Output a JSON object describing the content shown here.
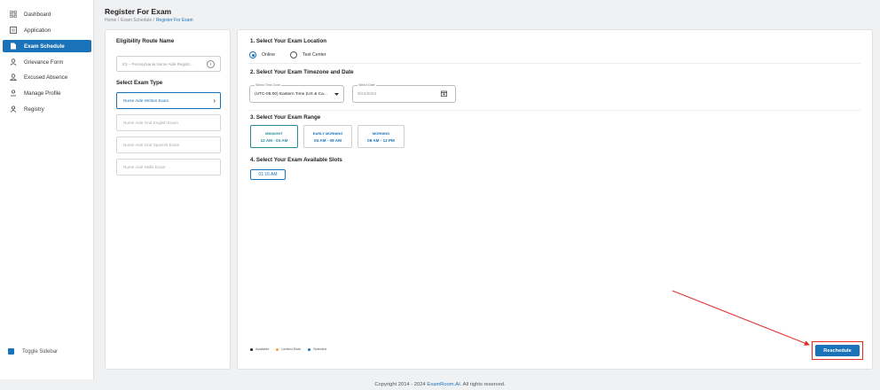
{
  "sidebar": {
    "items": [
      {
        "label": "Dashboard",
        "icon": "grid-icon"
      },
      {
        "label": "Application",
        "icon": "document-icon"
      },
      {
        "label": "Exam Schedule",
        "icon": "file-icon",
        "active": true
      },
      {
        "label": "Grievance Form",
        "icon": "user-icon"
      },
      {
        "label": "Excused Absence",
        "icon": "user-warning-icon"
      },
      {
        "label": "Manage Profile",
        "icon": "profile-icon"
      },
      {
        "label": "Registry",
        "icon": "registry-icon"
      }
    ],
    "toggle_label": "Toggle Sidebar"
  },
  "header": {
    "title": "Register For Exam",
    "breadcrumb": [
      "Home /",
      "Exam Schedule /",
      "Register For Exam"
    ]
  },
  "left": {
    "route_heading": "Eligibility Route Name",
    "route_value": "E3 – Pennsylvania Nurse Aide Registr...",
    "exam_type_heading": "Select Exam Type",
    "exam_types": [
      "Nurse Aide Written Exam",
      "Nurse Aide Oral English Exam",
      "Nurse Aide Oral Spanish Exam",
      "Nurse Aide Skills Exam"
    ]
  },
  "right": {
    "sec1": "1. Select Your Exam Location",
    "location_online": "Online",
    "location_center": "Test Center",
    "sec2": "2. Select Your Exam Timezone and Date",
    "timezone_label": "Select Time Zone",
    "timezone_value": "(UTC-05:00) Eastern Time (US & Ca...",
    "date_label": "Select Date",
    "date_value": "8/24/2024",
    "sec3": "3. Select Your Exam Range",
    "ranges": [
      {
        "name": "MIDNIGHT",
        "time": "12 AM - 04 AM"
      },
      {
        "name": "EARLY MORNING",
        "time": "04 AM - 08 AM"
      },
      {
        "name": "MORNING",
        "time": "08 AM - 12 PM"
      }
    ],
    "sec4": "4. Select Your Exam Available Slots",
    "slot": "01:16 AM",
    "legend": [
      {
        "label": "Available",
        "color": "#222222"
      },
      {
        "label": "Limited Slots",
        "color": "#f0a030"
      },
      {
        "label": "Selected",
        "color": "#1a73b8"
      }
    ],
    "reschedule_label": "Reschedule"
  },
  "footer": {
    "text_pre": "Copyright 2014 - 2024",
    "brand": "ExamRoom.AI.",
    "text_post": "All rights reserved."
  },
  "colors": {
    "accent": "#1a73b8",
    "annotation": "#e02a2a"
  }
}
